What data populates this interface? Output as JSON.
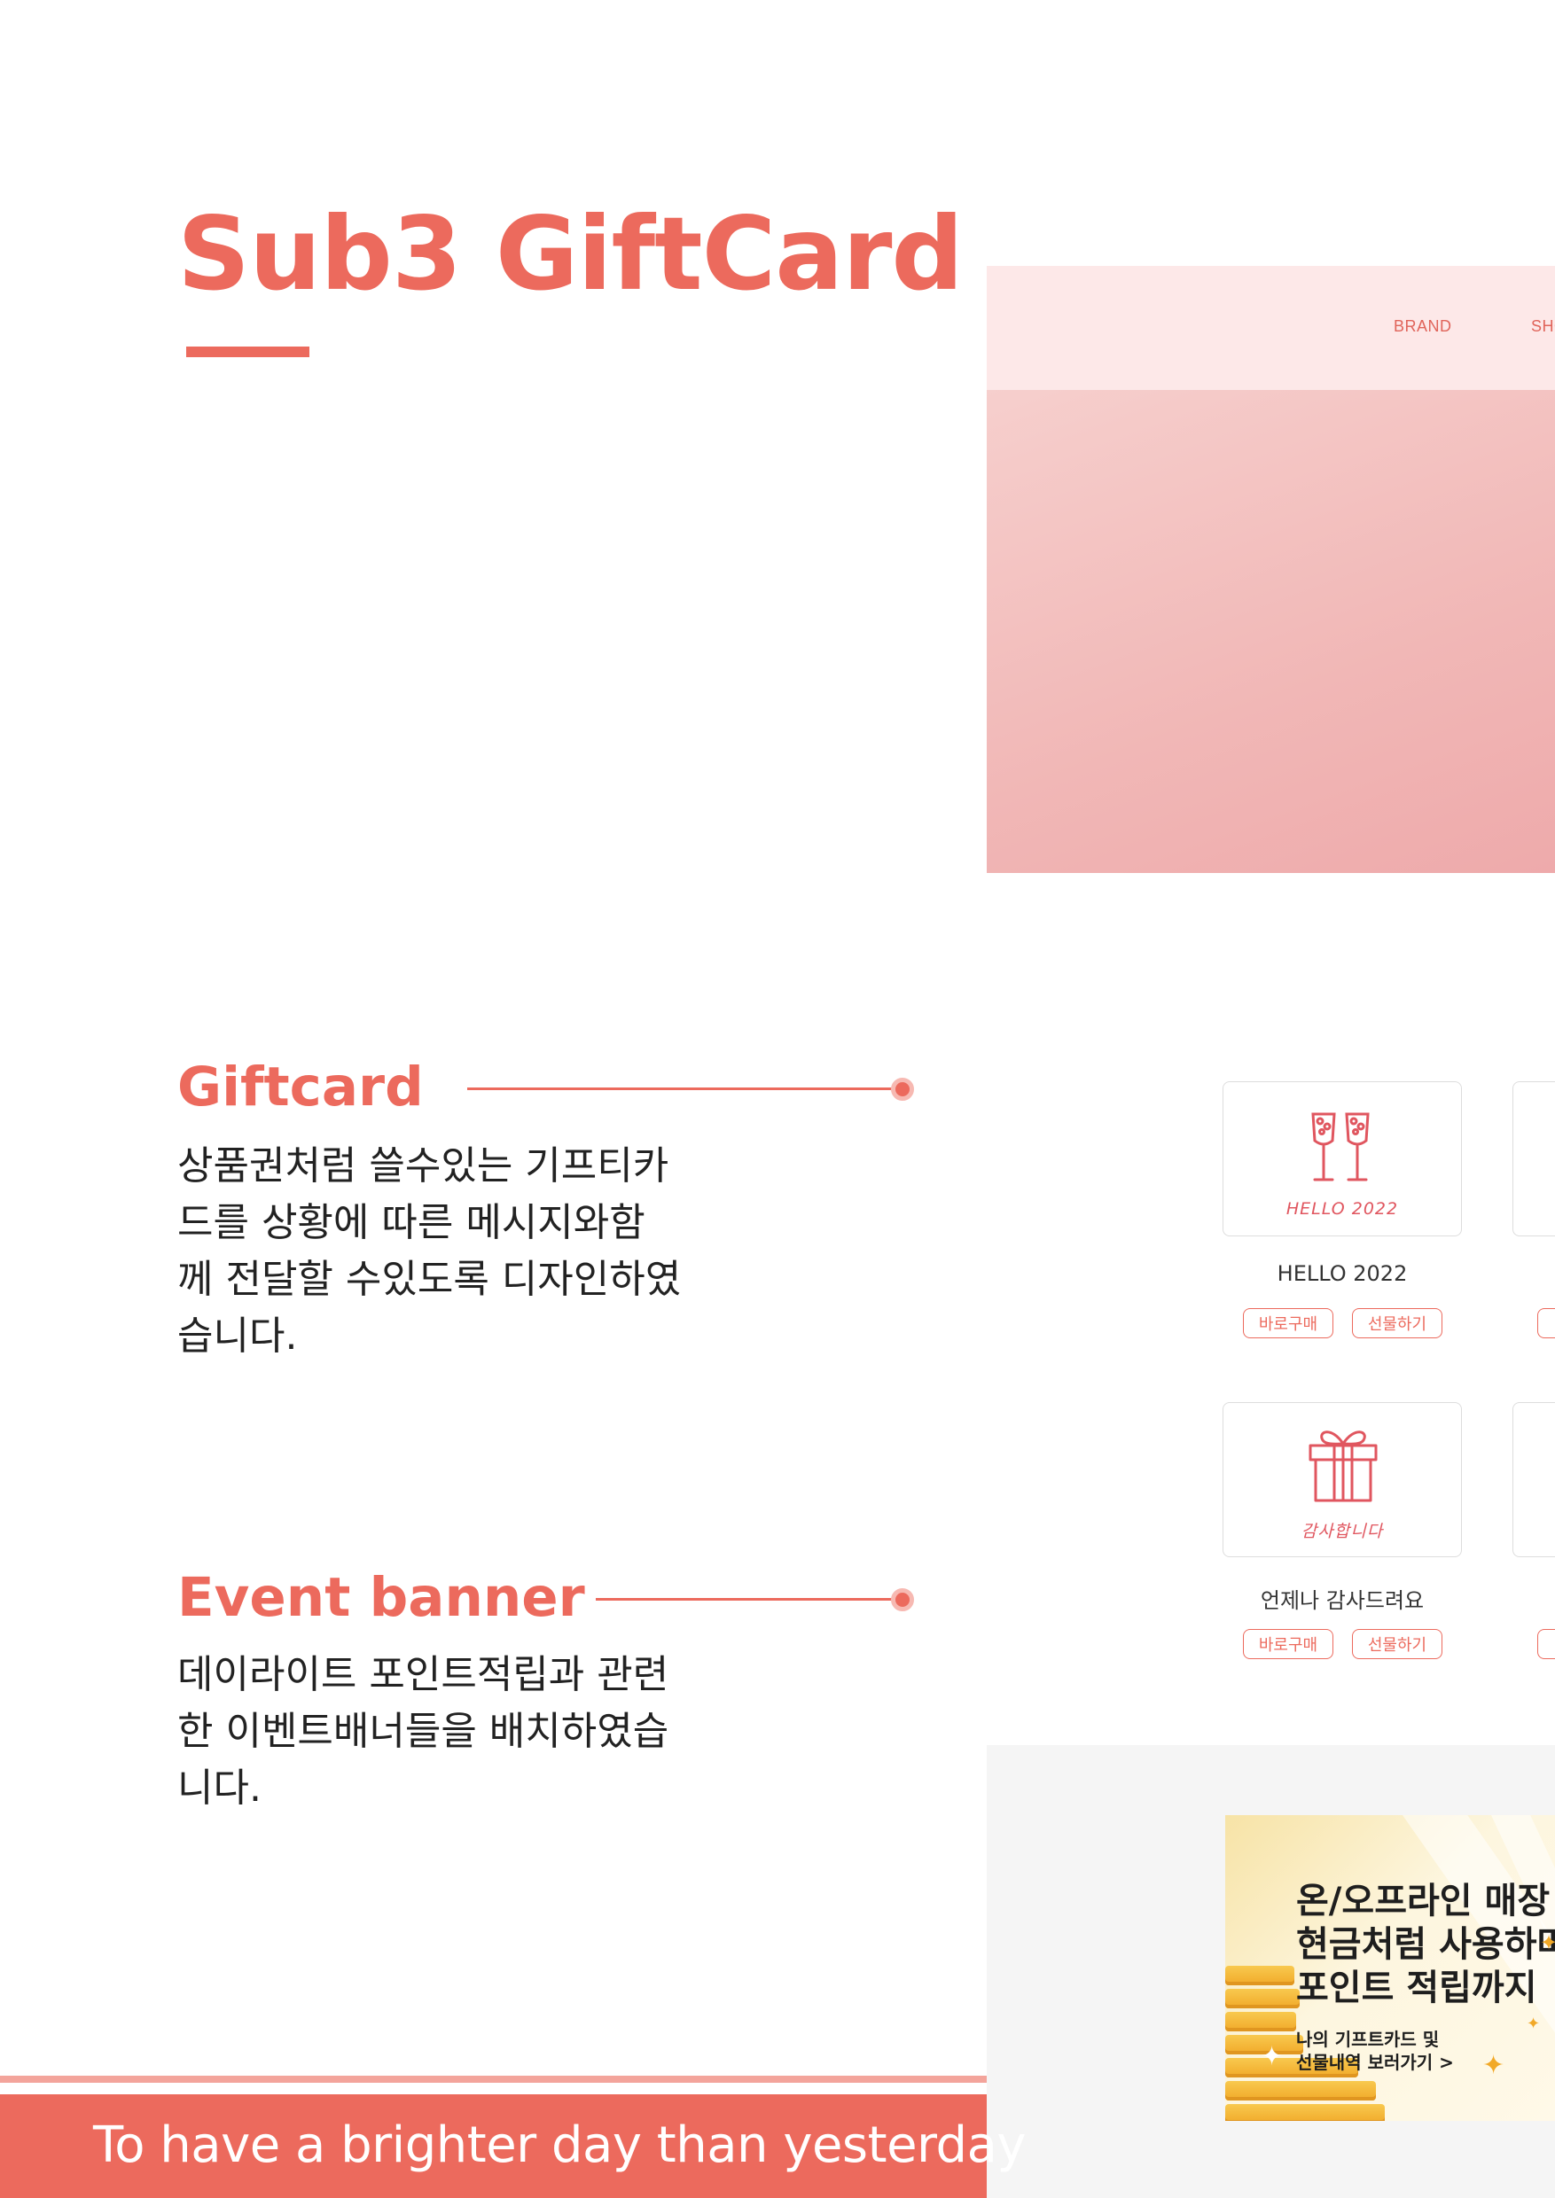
{
  "title": "Sub3 GiftCard",
  "hero": {
    "nav": [
      "BRAND",
      "SHO"
    ],
    "colors": {
      "nav_bg": "#fde8e8",
      "image": "#f1b7b6"
    }
  },
  "sections": {
    "giftcard": {
      "title": "Giftcard",
      "desc": [
        "상품권처럼 쓸수있는 기프티카",
        "드를 상황에 따른 메시지와함",
        "께 전달할 수있도록 디자인하였",
        "습니다."
      ]
    },
    "event": {
      "title": "Event banner",
      "desc": [
        "데이라이트 포인트적립과 관련",
        "한 이벤트배너들을 배치하였습",
        "니다."
      ]
    }
  },
  "cards": [
    {
      "caption": "HELLO 2022",
      "name": "HELLO 2022",
      "icon": "champagne-glasses-icon",
      "buy": "바로구매",
      "gift": "선물하기"
    },
    {
      "caption": "감사합니다",
      "name": "언제나 감사드려요",
      "icon": "gift-box-icon",
      "buy": "바로구매",
      "gift": "선물하기"
    }
  ],
  "event_banner": {
    "lines": [
      "온/오프라인 매장",
      "현금처럼 사용하며",
      "포인트 적립까지"
    ],
    "sub": [
      "나의 기프트카드 및",
      "선물내역 보러가기 >"
    ]
  },
  "footer": "To have a brighter day than yesterday",
  "colors": {
    "accent": "#ec6a5d",
    "footer_line": "#f3a49b",
    "event_bg": "#f5f5f5"
  }
}
